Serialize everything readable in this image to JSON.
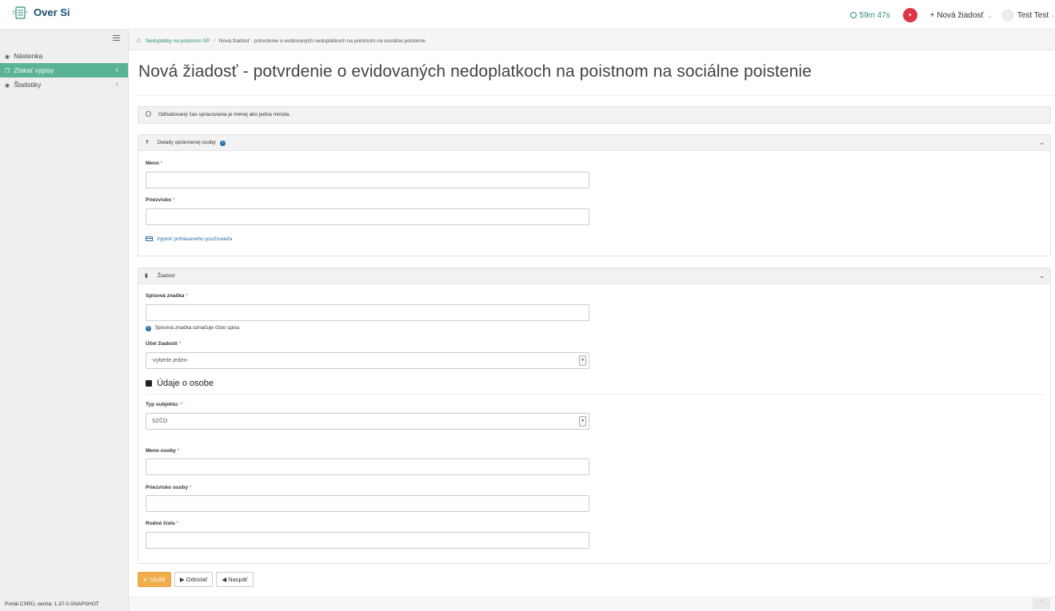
{
  "app": {
    "logo_text": "Over Si",
    "logo_subtext": ""
  },
  "topbar": {
    "timer": "59m 47s",
    "new_request_label": "+ Nová žiadosť",
    "user_name": "Test Test"
  },
  "sidebar": {
    "items": [
      {
        "label": "Nástenka",
        "icon": "dashboard-icon"
      },
      {
        "label": "Získať výpisy",
        "icon": "copy-icon"
      },
      {
        "label": "Štatistiky",
        "icon": "stats-icon"
      }
    ],
    "footer": "Portál CSRÚ, verzia: 1.37.0-SNAPSHOT"
  },
  "breadcrumb": {
    "link": "Nedoplatky na poistnom SP",
    "current": "Nová žiadosť - potvrdenie o evidovaných nedoplatkoch na poistnom na sociálne poistenie"
  },
  "page": {
    "title": "Nová žiadosť - potvrdenie o evidovaných nedoplatkoch na poistnom na sociálne poistenie",
    "info": "Odhadovaný čas spracovania je menej ako jedna minúta."
  },
  "panel_authorized": {
    "title": "Detaily oprávnenej osoby",
    "meno_label": "Meno",
    "priezvisko_label": "Priezvisko",
    "meno_value": "",
    "priezvisko_value": "",
    "fill_link": "Vyplniť prihláseného používateľa"
  },
  "panel_request": {
    "title": "Žiadosť",
    "spisova_label": "Spisová značka",
    "spisova_value": "",
    "spisova_hint": "Spisová značka označuje číslo spisu",
    "ucel_label": "Účel žiadosti",
    "ucel_value": "-vyberte jeden-",
    "section_title": "Údaje o osobe",
    "typ_label": "Typ subjektu:",
    "typ_value": "SZČO",
    "meno_osoby_label": "Meno osoby",
    "priezvisko_osoby_label": "Priezvisko osoby",
    "rodne_cislo_label": "Rodné číslo",
    "meno_osoby_value": "",
    "priezvisko_osoby_value": "",
    "rodne_cislo_value": ""
  },
  "actions": {
    "save": "Uložiť",
    "send": "Odoslať",
    "back": "Naspäť"
  },
  "required_mark": "*"
}
